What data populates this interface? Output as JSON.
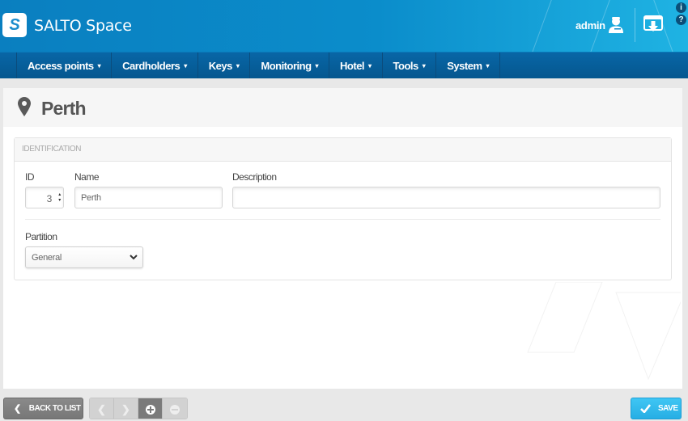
{
  "app": {
    "logo_letter": "S",
    "brand": "SALTO Space",
    "user_name": "admin",
    "info_glyph": "i",
    "help_glyph": "?"
  },
  "nav": {
    "items": [
      {
        "label": "Access points",
        "icon": "chevron-down"
      },
      {
        "label": "Cardholders",
        "icon": "chevron-down"
      },
      {
        "label": "Keys",
        "icon": "chevron-down"
      },
      {
        "label": "Monitoring",
        "icon": "chevron-down"
      },
      {
        "label": "Hotel",
        "icon": "chevron-down"
      },
      {
        "label": "Tools",
        "icon": "chevron-down"
      },
      {
        "label": "System",
        "icon": "chevron-down"
      }
    ],
    "chevron_glyph": "▾"
  },
  "page": {
    "title": "Perth",
    "title_icon": "map-marker"
  },
  "identification": {
    "section_title": "IDENTIFICATION",
    "id_label": "ID",
    "id_value": "3",
    "name_label": "Name",
    "name_value": "Perth",
    "description_label": "Description",
    "description_value": "",
    "partition_label": "Partition",
    "partition_value": "General"
  },
  "footer": {
    "back_label": "BACK TO LIST",
    "back_glyph": "❮",
    "prev_glyph": "❮",
    "next_glyph": "❯",
    "save_label": "SAVE"
  },
  "colors": {
    "header_blue": "#0b8dcb",
    "nav_blue": "#05578f",
    "save_blue": "#27aee4",
    "back_gray": "#7a7a7a"
  }
}
